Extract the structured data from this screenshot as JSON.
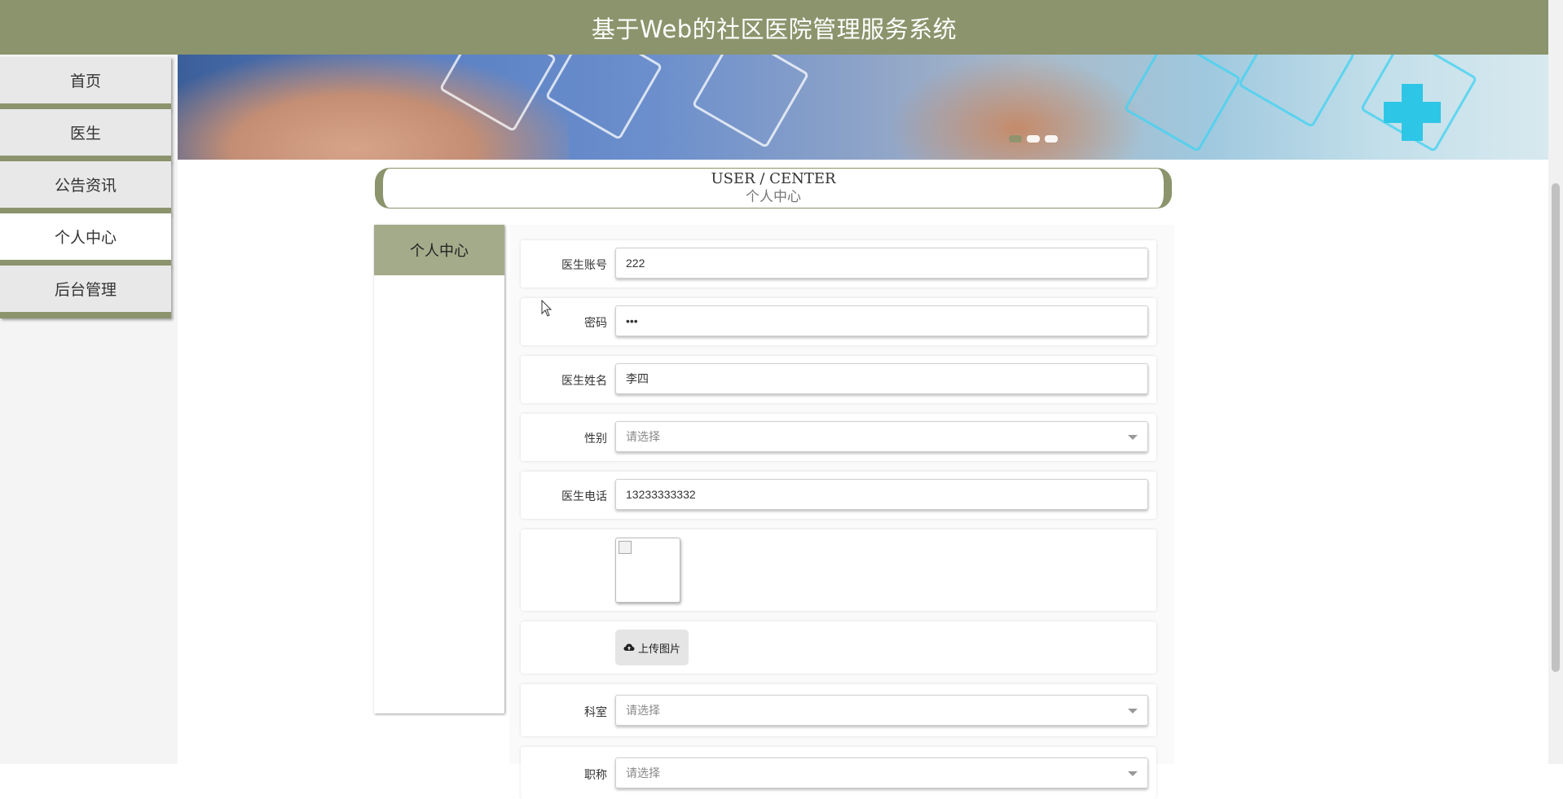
{
  "header": {
    "title": "基于Web的社区医院管理服务系统"
  },
  "sidebar": {
    "items": [
      {
        "label": "首页"
      },
      {
        "label": "医生"
      },
      {
        "label": "公告资讯"
      },
      {
        "label": "个人中心"
      },
      {
        "label": "后台管理"
      }
    ]
  },
  "banner": {
    "indicators": 3
  },
  "section": {
    "title_en": "USER / CENTER",
    "title_cn": "个人中心"
  },
  "left_panel": {
    "tab_label": "个人中心"
  },
  "form": {
    "account": {
      "label": "医生账号",
      "value": "222"
    },
    "password": {
      "label": "密码",
      "value": "•••"
    },
    "name": {
      "label": "医生姓名",
      "value": "李四"
    },
    "gender": {
      "label": "性别",
      "placeholder": "请选择"
    },
    "phone": {
      "label": "医生电话",
      "value": "13233333332"
    },
    "upload": {
      "label": "上传图片"
    },
    "department": {
      "label": "科室",
      "placeholder": "请选择"
    },
    "title": {
      "label": "职称",
      "placeholder": "请选择"
    }
  },
  "colors": {
    "accent": "#8b946c",
    "tab": "#a4ab8a"
  }
}
